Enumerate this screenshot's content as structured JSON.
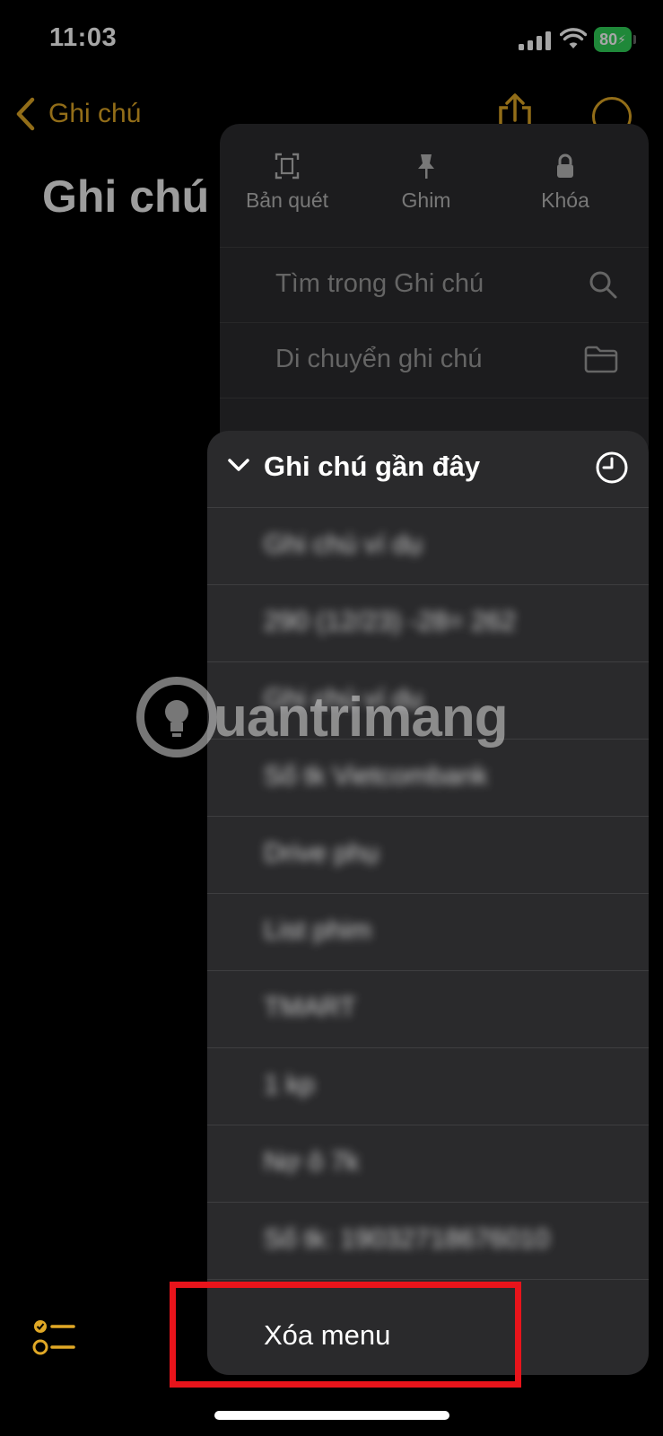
{
  "status_bar": {
    "time": "11:03",
    "battery": "80"
  },
  "nav": {
    "back_label": "Ghi chú"
  },
  "page_title": "Ghi chú",
  "menu": {
    "top_actions": [
      {
        "label": "Bản quét",
        "icon": "scan-icon"
      },
      {
        "label": "Ghim",
        "icon": "pin-icon"
      },
      {
        "label": "Khóa",
        "icon": "lock-icon"
      }
    ],
    "items": [
      {
        "label": "Tìm trong Ghi chú",
        "icon": "search-icon"
      },
      {
        "label": "Di chuyển ghi chú",
        "icon": "folder-icon"
      }
    ]
  },
  "recent": {
    "title": "Ghi chú gần đây",
    "notes": [
      "Ghi chú ví dụ",
      "290 (12/23) -28= 262",
      "Ghi chú ví dụ",
      "Số tk Vietcombank",
      "Drive phụ",
      "List phim",
      "TMART",
      "1 kp",
      "Nợ ô 7k",
      "Số tk: 19032718676010"
    ],
    "clear_label": "Xóa menu"
  },
  "watermark": "uantrimang",
  "colors": {
    "accent": "#e0a826",
    "highlight": "#e8141b",
    "battery": "#30d158"
  }
}
